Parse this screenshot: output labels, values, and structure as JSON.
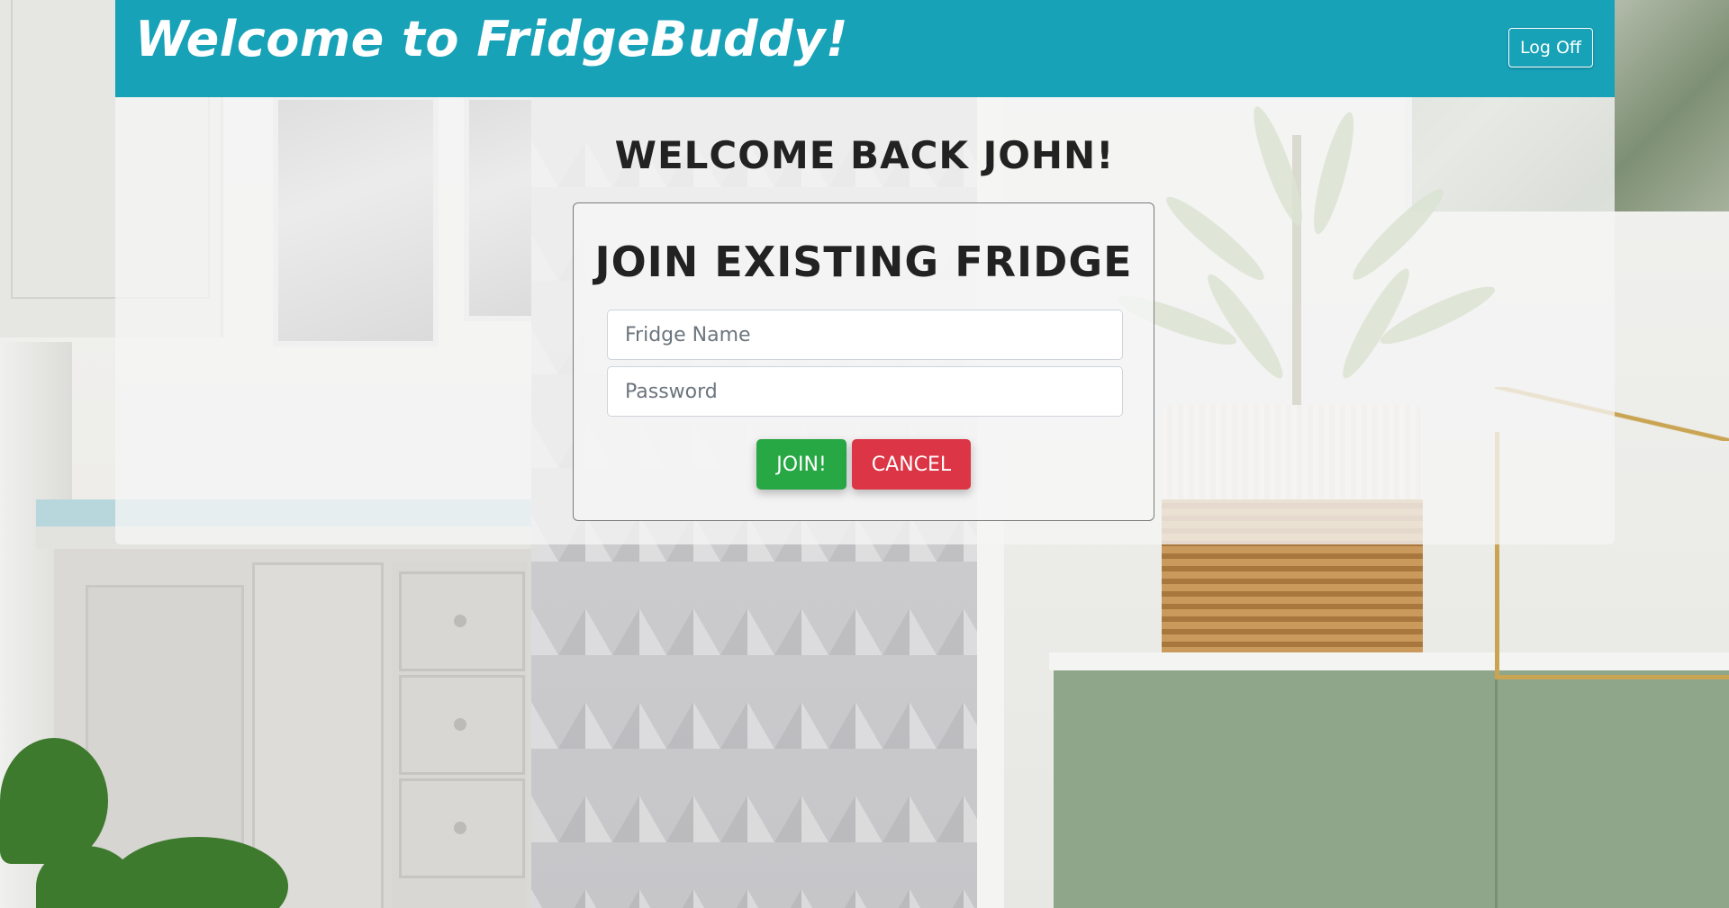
{
  "header": {
    "brand_title": "Welcome to FridgeBuddy!",
    "logoff_label": "Log Off"
  },
  "main": {
    "welcome_text": "WELCOME BACK JOHN!",
    "join_form": {
      "title": "JOIN EXISTING FRIDGE",
      "fridge_name": {
        "value": "",
        "placeholder": "Fridge Name"
      },
      "password": {
        "value": "",
        "placeholder": "Password"
      },
      "join_label": "JOIN!",
      "cancel_label": "CANCEL"
    }
  },
  "colors": {
    "navbar": "#17a2b8",
    "join_button": "#28a745",
    "cancel_button": "#dc3545",
    "heading_text": "#222222"
  }
}
